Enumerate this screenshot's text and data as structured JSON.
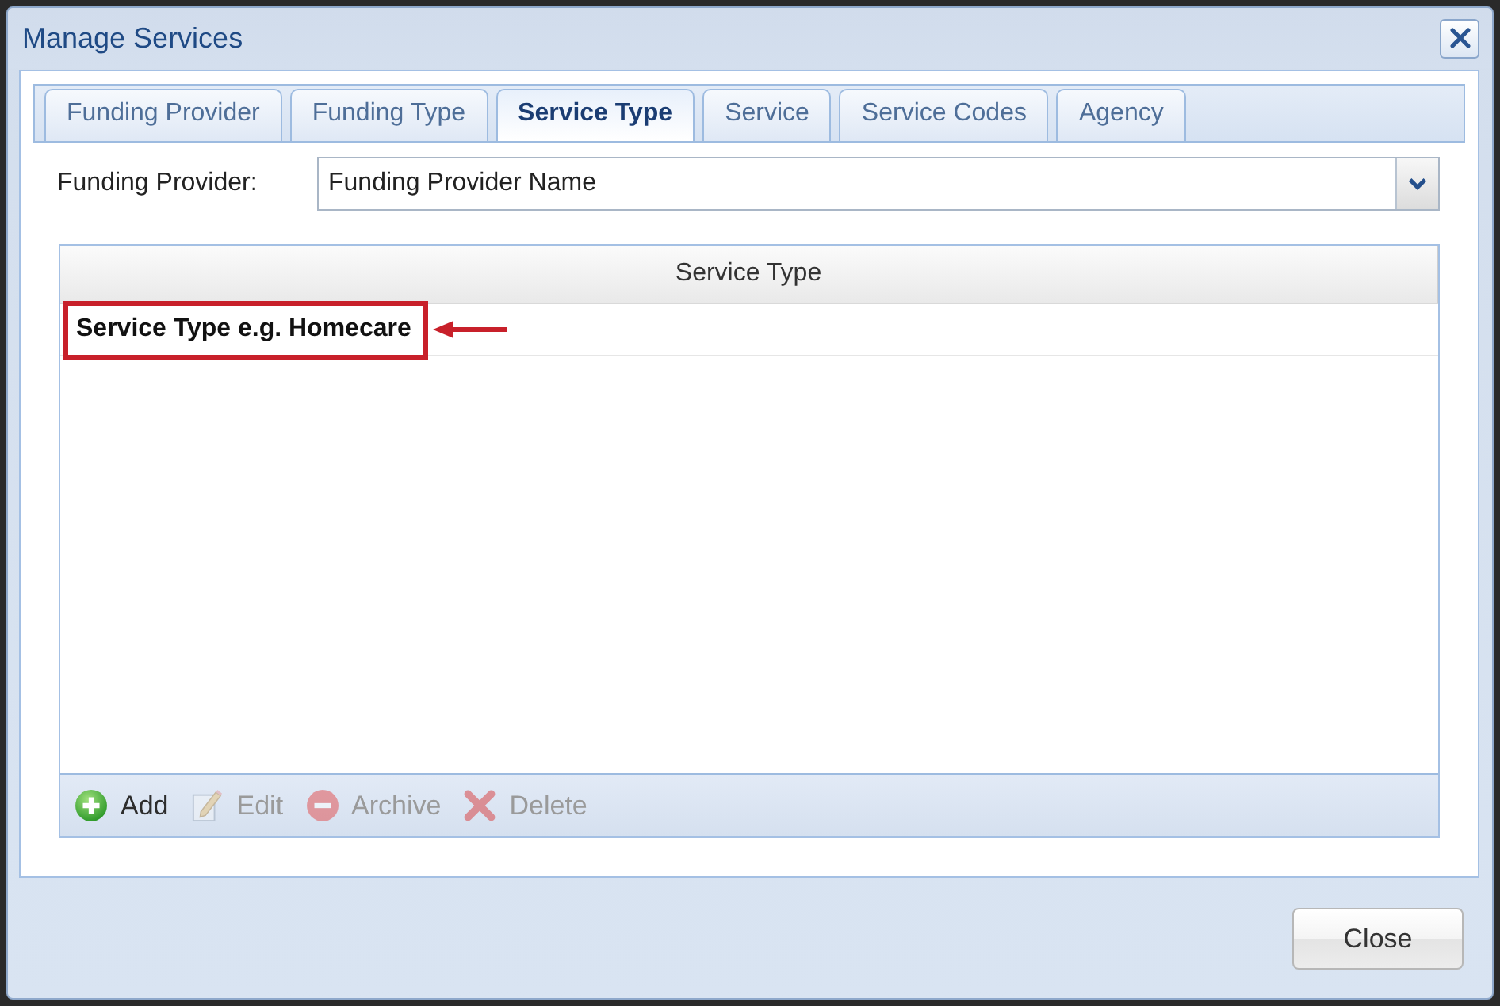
{
  "window": {
    "title": "Manage Services"
  },
  "tabs": [
    {
      "label": "Funding Provider",
      "selected": false
    },
    {
      "label": "Funding Type",
      "selected": false
    },
    {
      "label": "Service Type",
      "selected": true
    },
    {
      "label": "Service",
      "selected": false
    },
    {
      "label": "Service Codes",
      "selected": false
    },
    {
      "label": "Agency",
      "selected": false
    }
  ],
  "filter": {
    "label": "Funding Provider:",
    "value": "Funding Provider Name"
  },
  "table": {
    "columns": [
      "Service Type"
    ],
    "rows": [
      {
        "cells": [
          "Service Type e.g. Homecare"
        ],
        "highlighted": true
      }
    ]
  },
  "toolbar": [
    {
      "kind": "add",
      "label": "Add",
      "disabled": false
    },
    {
      "kind": "edit",
      "label": "Edit",
      "disabled": true
    },
    {
      "kind": "archive",
      "label": "Archive",
      "disabled": true
    },
    {
      "kind": "delete",
      "label": "Delete",
      "disabled": true
    }
  ],
  "buttons": [
    {
      "label": "Close"
    }
  ]
}
